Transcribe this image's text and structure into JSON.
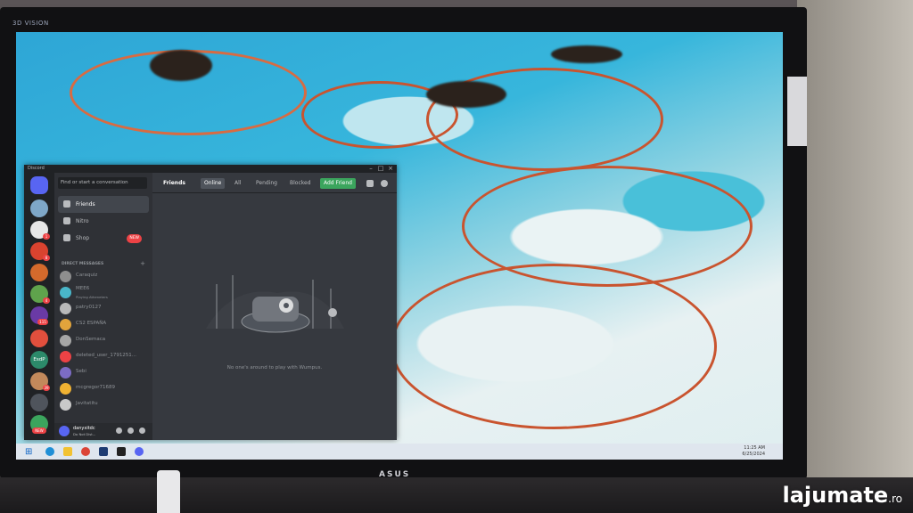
{
  "monitor": {
    "label": "3D VISION",
    "brand": "ASUS"
  },
  "discord": {
    "window_title": "Discord",
    "search_placeholder": "Find or start a conversation",
    "nav": [
      {
        "label": "Friends"
      },
      {
        "label": "Nitro"
      },
      {
        "label": "Shop",
        "badge": "NEW"
      }
    ],
    "dm_header": "DIRECT MESSAGES",
    "dm_plus": "+",
    "dms": [
      {
        "name": "Caraquiz"
      },
      {
        "name": "MEE6",
        "status": "Playing Atheneters"
      },
      {
        "name": "patry0127"
      },
      {
        "name": "CS2 ESPAÑA"
      },
      {
        "name": "DonSemaca"
      },
      {
        "name": "deleted_user_1791251..."
      },
      {
        "name": "Sebi"
      },
      {
        "name": "mcgregor71689"
      },
      {
        "name": "Javitatitu"
      }
    ],
    "user": {
      "name": "danyxitdc",
      "status": "Do Not Dist..."
    },
    "guild_badges": [
      "1",
      "8",
      "4",
      "115",
      "39"
    ],
    "guild_text": "EsdP",
    "guild_new": "NEW",
    "topbar": {
      "title": "Friends",
      "tabs": [
        "Online",
        "All",
        "Pending",
        "Blocked"
      ],
      "add_friend": "Add Friend"
    },
    "empty_text": "No one's around to play with Wumpus."
  },
  "taskbar": {
    "time": "11:25 AM",
    "date": "6/25/2024"
  },
  "watermark": {
    "brand": "lajumate",
    "tld": ".ro"
  }
}
